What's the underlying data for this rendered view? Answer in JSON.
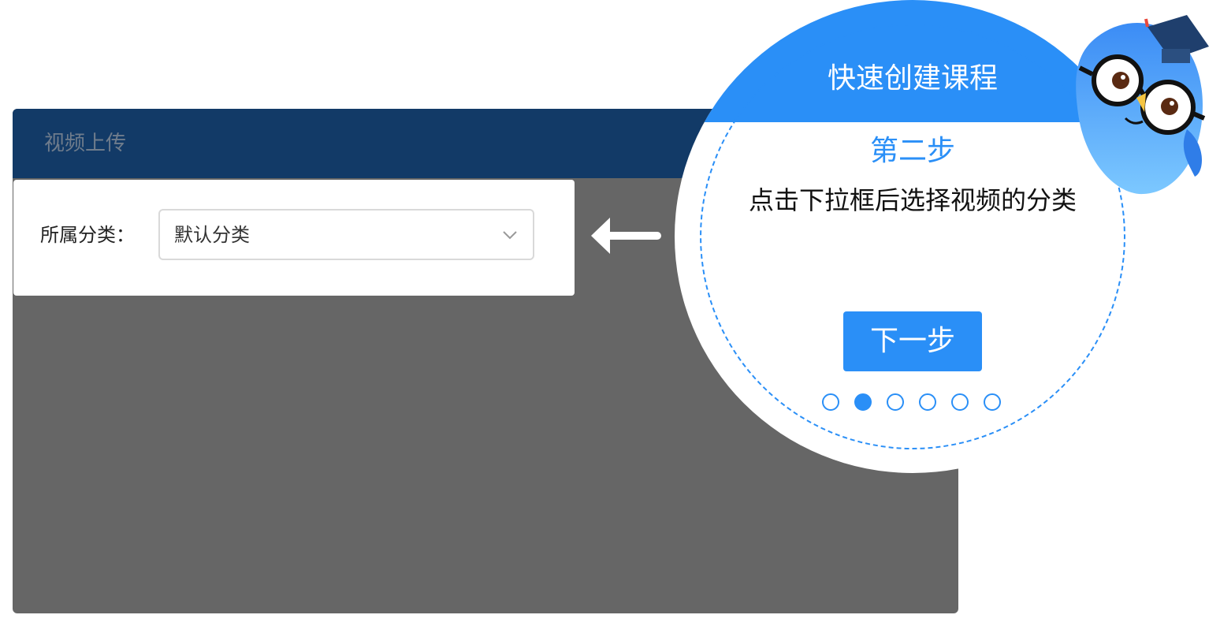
{
  "dialog": {
    "title": "视频上传",
    "header_color": "#123a67",
    "overlay_color": "#666666"
  },
  "form": {
    "category_label": "所属分类：",
    "category_select": {
      "value": "默认分类",
      "icon": "chevron-down-icon"
    }
  },
  "pointer": {
    "icon": "arrow-left-icon"
  },
  "guide": {
    "title": "快速创建课程",
    "step_title": "第二步",
    "step_description": "点击下拉框后选择视频的分类",
    "next_button": "下一步",
    "total_steps": 6,
    "current_step": 2,
    "accent_color": "#2a8ff7"
  },
  "mascot": {
    "icon": "owl-mascot-icon"
  }
}
